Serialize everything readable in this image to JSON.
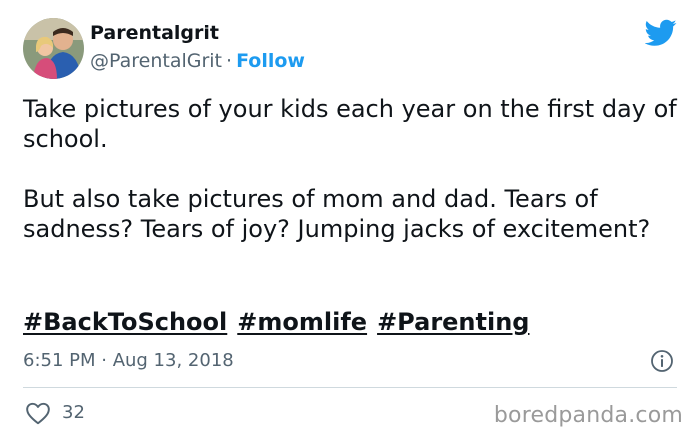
{
  "author": {
    "name": "Parentalgrit",
    "handle": "@ParentalGrit",
    "separator": "·",
    "follow_label": "Follow"
  },
  "tweet": {
    "paragraphs": [
      "Take pictures of your kids each year on the first day of school.",
      "But also take pictures of mom and dad. Tears of sadness? Tears of joy? Jumping jacks of excitement?"
    ],
    "hashtags": [
      "#BackToSchool",
      "#momlife",
      "#Parenting"
    ],
    "timestamp": "6:51 PM · Aug 13, 2018",
    "likes": "32"
  },
  "watermark": "boredpanda.com",
  "icons": {
    "brand": "twitter-bird-icon",
    "info": "info-icon",
    "like": "heart-icon"
  },
  "colors": {
    "accent": "#1d9bf0",
    "text": "#0f1419",
    "secondary": "#536471"
  }
}
